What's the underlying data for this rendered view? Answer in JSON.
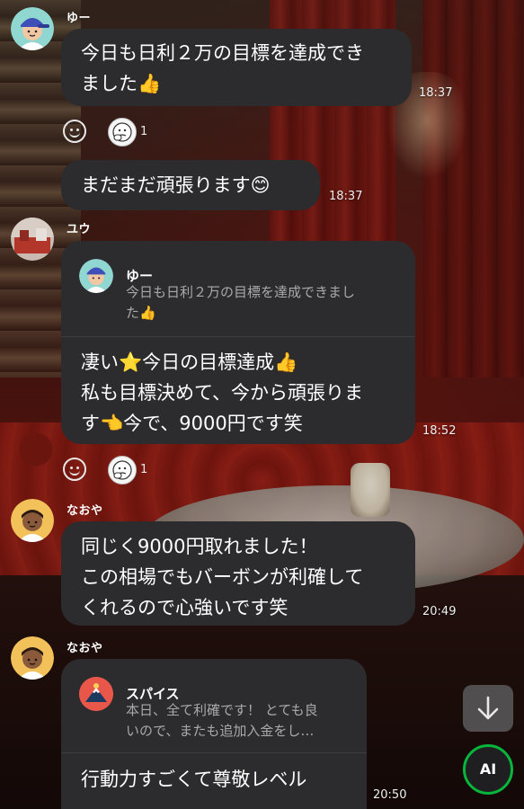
{
  "messages": [
    {
      "sender": "ゆー",
      "avatar_icon": "user-avatar-blue-cap",
      "text": "今日も日利２万の目標を達成でき\nました👍",
      "time": "18:37",
      "reaction_count": "1"
    },
    {
      "text": "まだまだ頑張ります😊",
      "time": "18:37"
    },
    {
      "sender": "ユウ",
      "avatar_icon": "room-photo-avatar",
      "quote": {
        "sender": "ゆー",
        "text": "今日も日利２万の目標を達成できまし\nた👍"
      },
      "text": "凄い⭐今日の目標達成👍\n私も目標決めて、今から頑張りま\nす👈今で、9000円です笑",
      "time": "18:52",
      "reaction_count": "1"
    },
    {
      "sender": "なおや",
      "avatar_icon": "user-avatar-dark-hair",
      "text": "同じく9000円取れました！\nこの相場でもバーボンが利確して\nくれるので心強いです笑",
      "time": "20:49"
    },
    {
      "sender": "なおや",
      "avatar_icon": "user-avatar-dark-hair",
      "quote": {
        "sender": "スパイス",
        "text": "本日、全て利確です！ とても良\nいので、またも追加入金をし…"
      },
      "text": "行動力すごくて尊敬レベル",
      "time": "20:50"
    }
  ],
  "controls": {
    "scroll_icon": "arrow-down-icon",
    "ai_label": "AI"
  },
  "colors": {
    "bubble": "#2c2c2e",
    "ai_ring": "#07b53b"
  }
}
